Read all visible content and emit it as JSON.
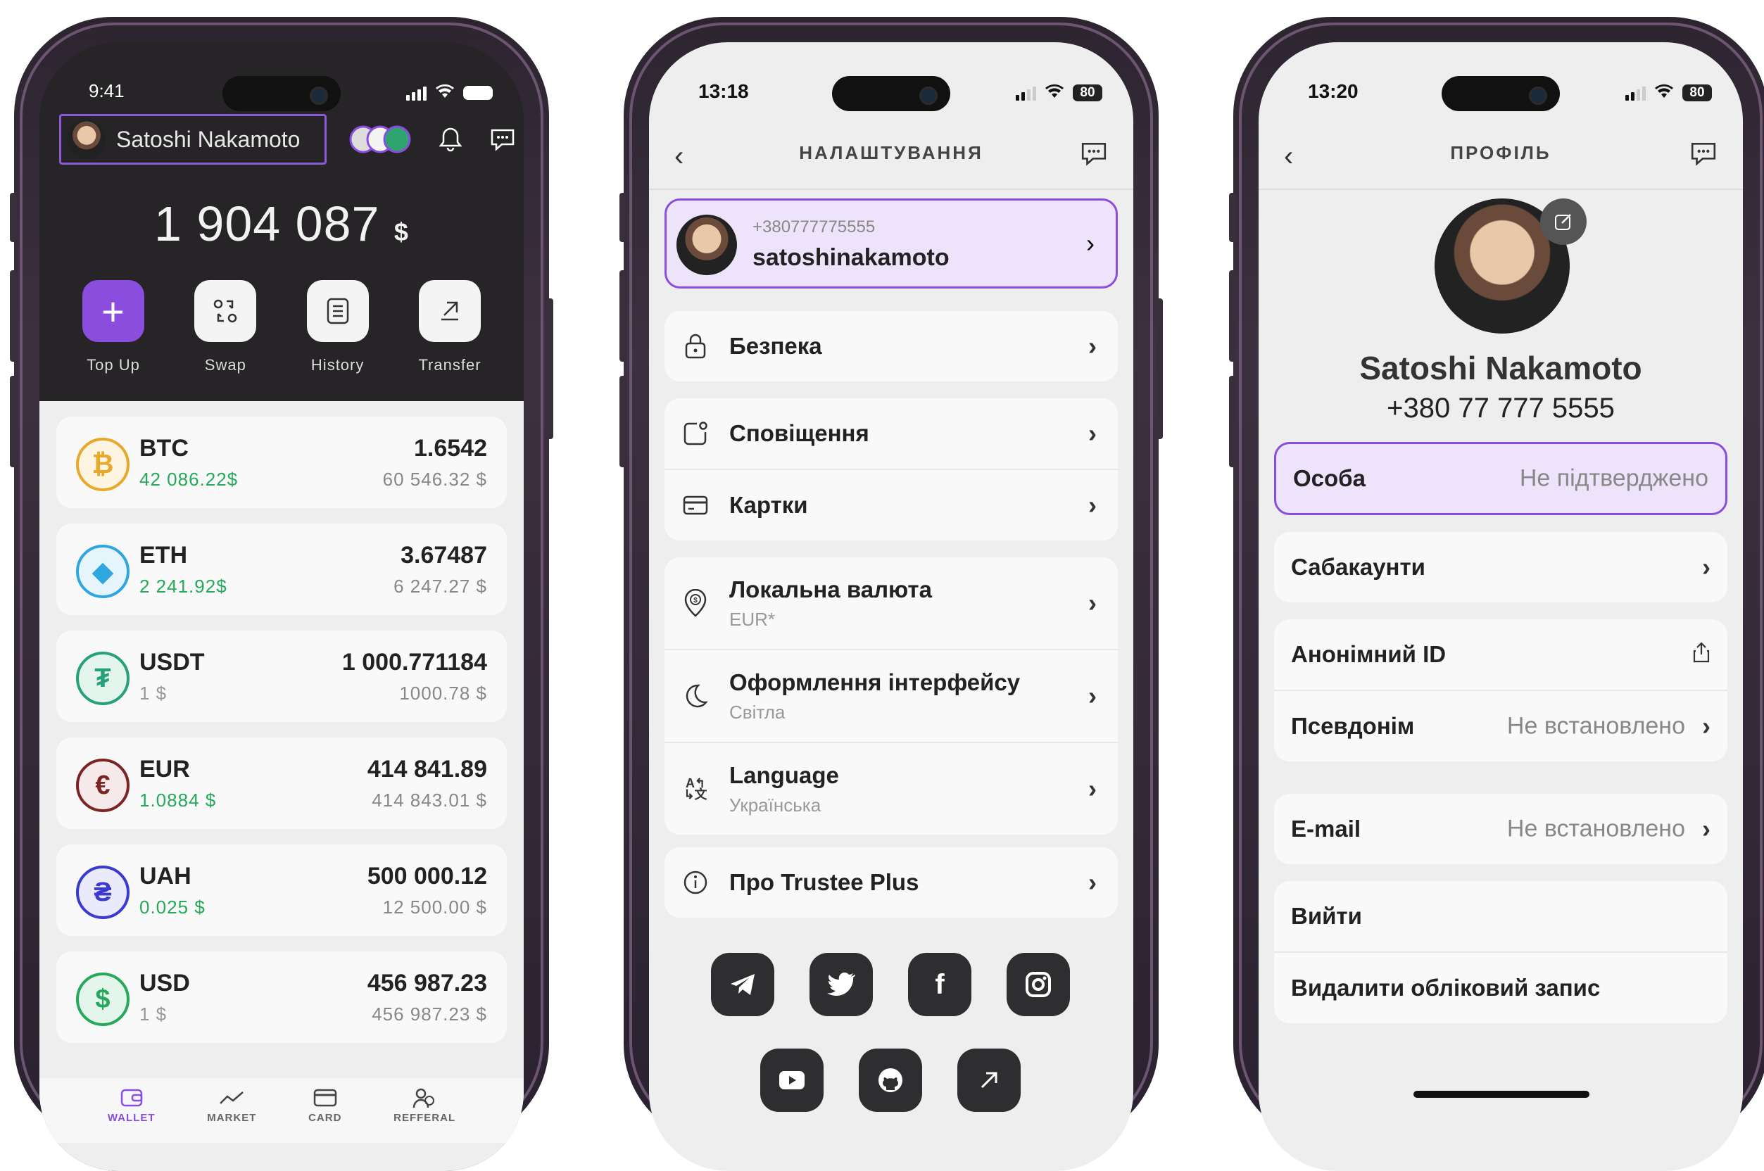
{
  "phone1": {
    "status_time": "9:41",
    "user_name": "Satoshi Nakamoto",
    "balance_value": "1 904 087",
    "balance_currency": "$",
    "actions": [
      {
        "label": "Top Up"
      },
      {
        "label": "Swap"
      },
      {
        "label": "History"
      },
      {
        "label": "Transfer"
      }
    ],
    "coins": [
      {
        "symbol": "BTC",
        "rate": "42 086.22$",
        "amount": "1.6542",
        "fiat": "60 546.32 $",
        "color": "#e7a92b",
        "glyph": "₿",
        "rate_color": "green"
      },
      {
        "symbol": "ETH",
        "rate": "2 241.92$",
        "amount": "3.67487",
        "fiat": "6 247.27 $",
        "color": "#2ea7e0",
        "glyph": "◆",
        "rate_color": "green"
      },
      {
        "symbol": "USDT",
        "rate": "1 $",
        "amount": "1 000.771184",
        "fiat": "1000.78 $",
        "color": "#26a17b",
        "glyph": "₮",
        "rate_color": "grey"
      },
      {
        "symbol": "EUR",
        "rate": "1.0884 $",
        "amount": "414 841.89",
        "fiat": "414 843.01 $",
        "color": "#7a2424",
        "glyph": "€",
        "rate_color": "green"
      },
      {
        "symbol": "UAH",
        "rate": "0.025 $",
        "amount": "500 000.12",
        "fiat": "12 500.00 $",
        "color": "#3a3ad0",
        "glyph": "₴",
        "rate_color": "green"
      },
      {
        "symbol": "USD",
        "rate": "1 $",
        "amount": "456 987.23",
        "fiat": "456 987.23 $",
        "color": "#26a95a",
        "glyph": "$",
        "rate_color": "grey"
      }
    ],
    "tabs": [
      {
        "label": "WALLET",
        "active": true
      },
      {
        "label": "MARKET"
      },
      {
        "label": "CARD"
      },
      {
        "label": "REFFERAL"
      }
    ]
  },
  "phone2": {
    "status_time": "13:18",
    "battery": "80",
    "title": "НАЛАШТУВАННЯ",
    "profile_phone": "+380777775555",
    "profile_username": "satoshinakamoto",
    "items": {
      "security": "Безпека",
      "notifications": "Сповіщення",
      "cards": "Картки",
      "currency": "Локальна валюта",
      "currency_sub": "EUR*",
      "theme": "Оформлення інтерфейсу",
      "theme_sub": "Світла",
      "language": "Language",
      "language_sub": "Українська",
      "about": "Про Trustee Plus"
    },
    "social": [
      "telegram-icon",
      "twitter-icon",
      "facebook-icon",
      "instagram-icon",
      "youtube-icon",
      "github-icon",
      "external-link-icon"
    ]
  },
  "phone3": {
    "status_time": "13:20",
    "battery": "80",
    "title": "ПРОФІЛЬ",
    "name": "Satoshi Nakamoto",
    "phone": "+380 77 777 5555",
    "person_label": "Особа",
    "person_value": "Не підтверджено",
    "subaccounts": "Сабакаунти",
    "anon_id": "Анонімний ID",
    "nickname": "Псевдонім",
    "nickname_value": "Не встановлено",
    "email": "E-mail",
    "email_value": "Не встановлено",
    "logout": "Вийти",
    "delete": "Видалити обліковий запис"
  },
  "colors": {
    "accent": "#8a4dde",
    "accent_soft": "#ede3fb",
    "green": "#26a95a"
  }
}
